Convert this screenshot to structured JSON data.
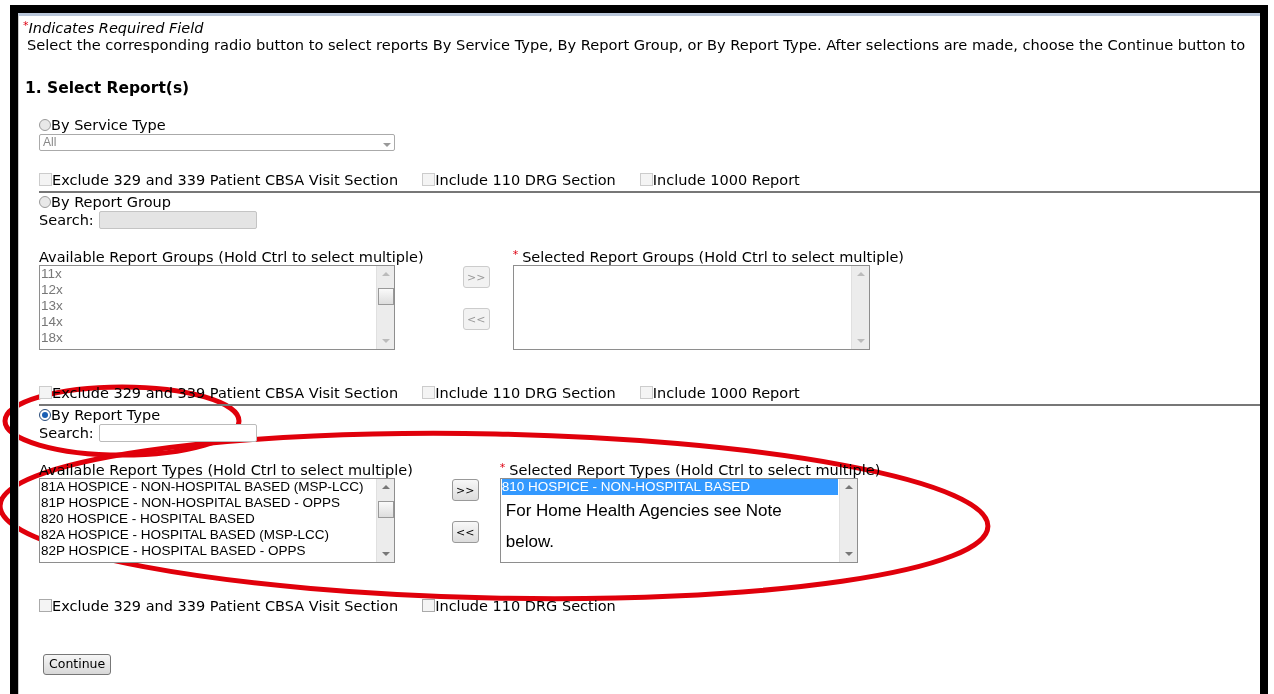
{
  "required_note": {
    "marker": "*",
    "text": "Indicates Required Field"
  },
  "instructions": "Select the corresponding radio button to select reports By Service Type, By Report Group, or By Report Type. After selections are made, choose the Continue button to",
  "heading": "1.  Select Report(s)",
  "sections": [
    {
      "kind": "dropdown",
      "label": "By Service Type",
      "selected": false,
      "disabled": true,
      "dropdown": {
        "value": "All"
      },
      "checkboxes": [
        {
          "label": "Exclude 329 and 339 Patient CBSA Visit Section",
          "checked": false
        },
        {
          "label": "Include 110 DRG Section",
          "checked": false
        },
        {
          "label": "Include 1000 Report",
          "checked": false
        }
      ]
    },
    {
      "kind": "picker",
      "label": "By Report Group",
      "selected": false,
      "disabled": true,
      "search_label": "Search:",
      "available": {
        "label": "Available Report Groups (Hold Ctrl to select multiple)",
        "items": [
          {
            "text": "11x",
            "selected": false
          },
          {
            "text": "12x",
            "selected": false
          },
          {
            "text": "13x",
            "selected": false
          },
          {
            "text": "14x",
            "selected": false
          },
          {
            "text": "18x",
            "selected": false
          }
        ]
      },
      "add_button": ">>",
      "remove_button": "<<",
      "chosen": {
        "marker": "*",
        "label": "Selected Report Groups (Hold Ctrl to select multiple)"
      },
      "checkboxes": [
        {
          "label": "Exclude 329 and 339 Patient CBSA Visit Section",
          "checked": false
        },
        {
          "label": "Include 110 DRG Section",
          "checked": false
        },
        {
          "label": "Include 1000 Report",
          "checked": false
        }
      ]
    },
    {
      "kind": "picker",
      "label": "By Report Type",
      "selected": true,
      "disabled": false,
      "search_label": "Search:",
      "available": {
        "label": "Available Report Types (Hold Ctrl to select multiple)",
        "items": [
          {
            "text": "81A HOSPICE - NON-HOSPITAL BASED (MSP-LCC)",
            "selected": false
          },
          {
            "text": "81P HOSPICE - NON-HOSPITAL BASED - OPPS",
            "selected": false
          },
          {
            "text": "820 HOSPICE - HOSPITAL BASED",
            "selected": false
          },
          {
            "text": "82A HOSPICE - HOSPITAL BASED (MSP-LCC)",
            "selected": false
          },
          {
            "text": "82P HOSPICE - HOSPITAL BASED - OPPS",
            "selected": false
          }
        ]
      },
      "add_button": ">>",
      "remove_button": "<<",
      "chosen": {
        "marker": "*",
        "label": "Selected Report Types (Hold Ctrl to select multiple)",
        "items": [
          {
            "text": "810 HOSPICE - NON-HOSPITAL BASED",
            "selected": true
          }
        ],
        "note": "For Home Health Agencies see Note below."
      },
      "checkboxes": [
        {
          "label": "Exclude 329 and 339 Patient CBSA Visit Section",
          "checked": false
        },
        {
          "label": "Include 110 DRG Section",
          "checked": false
        }
      ]
    }
  ],
  "continue_button": "Continue"
}
